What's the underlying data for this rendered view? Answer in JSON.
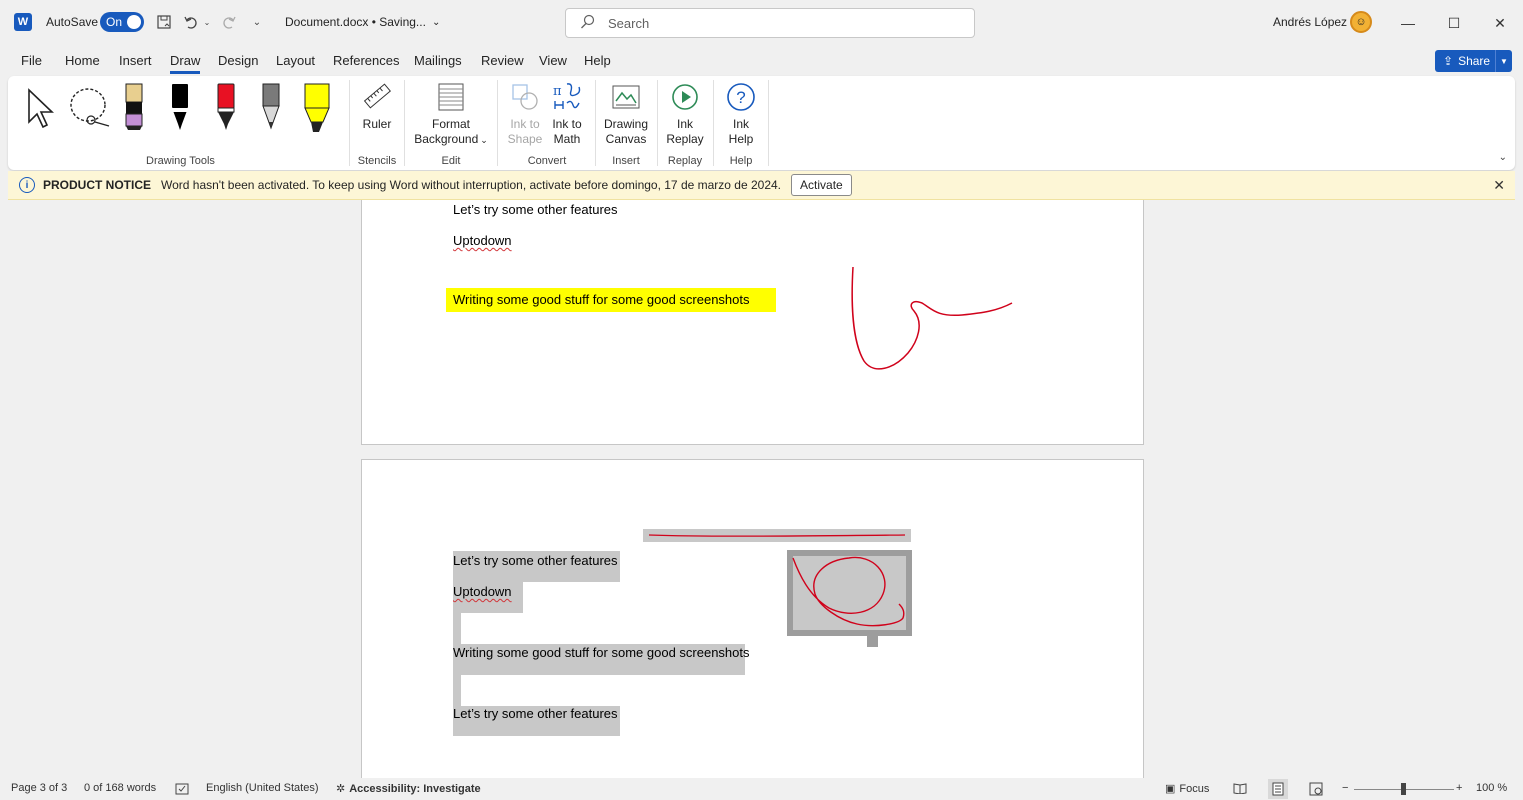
{
  "titlebar": {
    "app_icon": "word-logo-icon",
    "app_letter": "W",
    "autosave_label": "AutoSave",
    "autosave_state": "On",
    "document_name": "Document.docx • Saving...",
    "search_placeholder": "Search",
    "user_name": "Andrés López",
    "minimize": "—",
    "maximize": "☐",
    "close": "✕"
  },
  "menu": {
    "tabs": [
      "File",
      "Home",
      "Insert",
      "Draw",
      "Design",
      "Layout",
      "References",
      "Mailings",
      "Review",
      "View",
      "Help"
    ],
    "active_tab": "Draw",
    "share_label": "Share"
  },
  "ribbon": {
    "groups": {
      "drawing_tools": "Drawing Tools",
      "stencils": "Stencils",
      "edit": "Edit",
      "convert": "Convert",
      "insert": "Insert",
      "replay": "Replay",
      "help": "Help"
    },
    "buttons": {
      "ruler": "Ruler",
      "format_background_1": "Format",
      "format_background_2": "Background",
      "ink_to_shape_1": "Ink to",
      "ink_to_shape_2": "Shape",
      "ink_to_math_1": "Ink to",
      "ink_to_math_2": "Math",
      "drawing_canvas_1": "Drawing",
      "drawing_canvas_2": "Canvas",
      "ink_replay_1": "Ink",
      "ink_replay_2": "Replay",
      "ink_help_1": "Ink",
      "ink_help_2": "Help"
    },
    "pen_colors": {
      "pencil_tip": "#e8cf8f",
      "pencil_band": "#c38fd6",
      "black_pen": "#000000",
      "red_pen": "#e81123",
      "gray_pencil": "#7a7a7a",
      "highlighter": "#ffff00"
    }
  },
  "notice": {
    "title": "PRODUCT NOTICE",
    "message": "Word hasn't been activated. To keep using Word without interruption, activate before domingo, 17 de marzo de 2024.",
    "button": "Activate"
  },
  "document": {
    "page1": {
      "line1": "Let’s try some other features",
      "line2": "Uptodown",
      "line3": "Writing some good stuff for some good screenshots"
    },
    "page2": {
      "line1": "Let’s try some other features",
      "line2": "Uptodown",
      "line3": "Writing some good stuff for some good screenshots",
      "line4": "Let’s try some other features"
    },
    "ink_color": "#d0021b",
    "selection_color": "#c8c8c8"
  },
  "status": {
    "page": "Page 3 of 3",
    "words": "0 of 168 words",
    "language": "English (United States)",
    "accessibility": "Accessibility: Investigate",
    "focus": "Focus",
    "zoom_level": "100 %",
    "zoom_percent": 100
  }
}
